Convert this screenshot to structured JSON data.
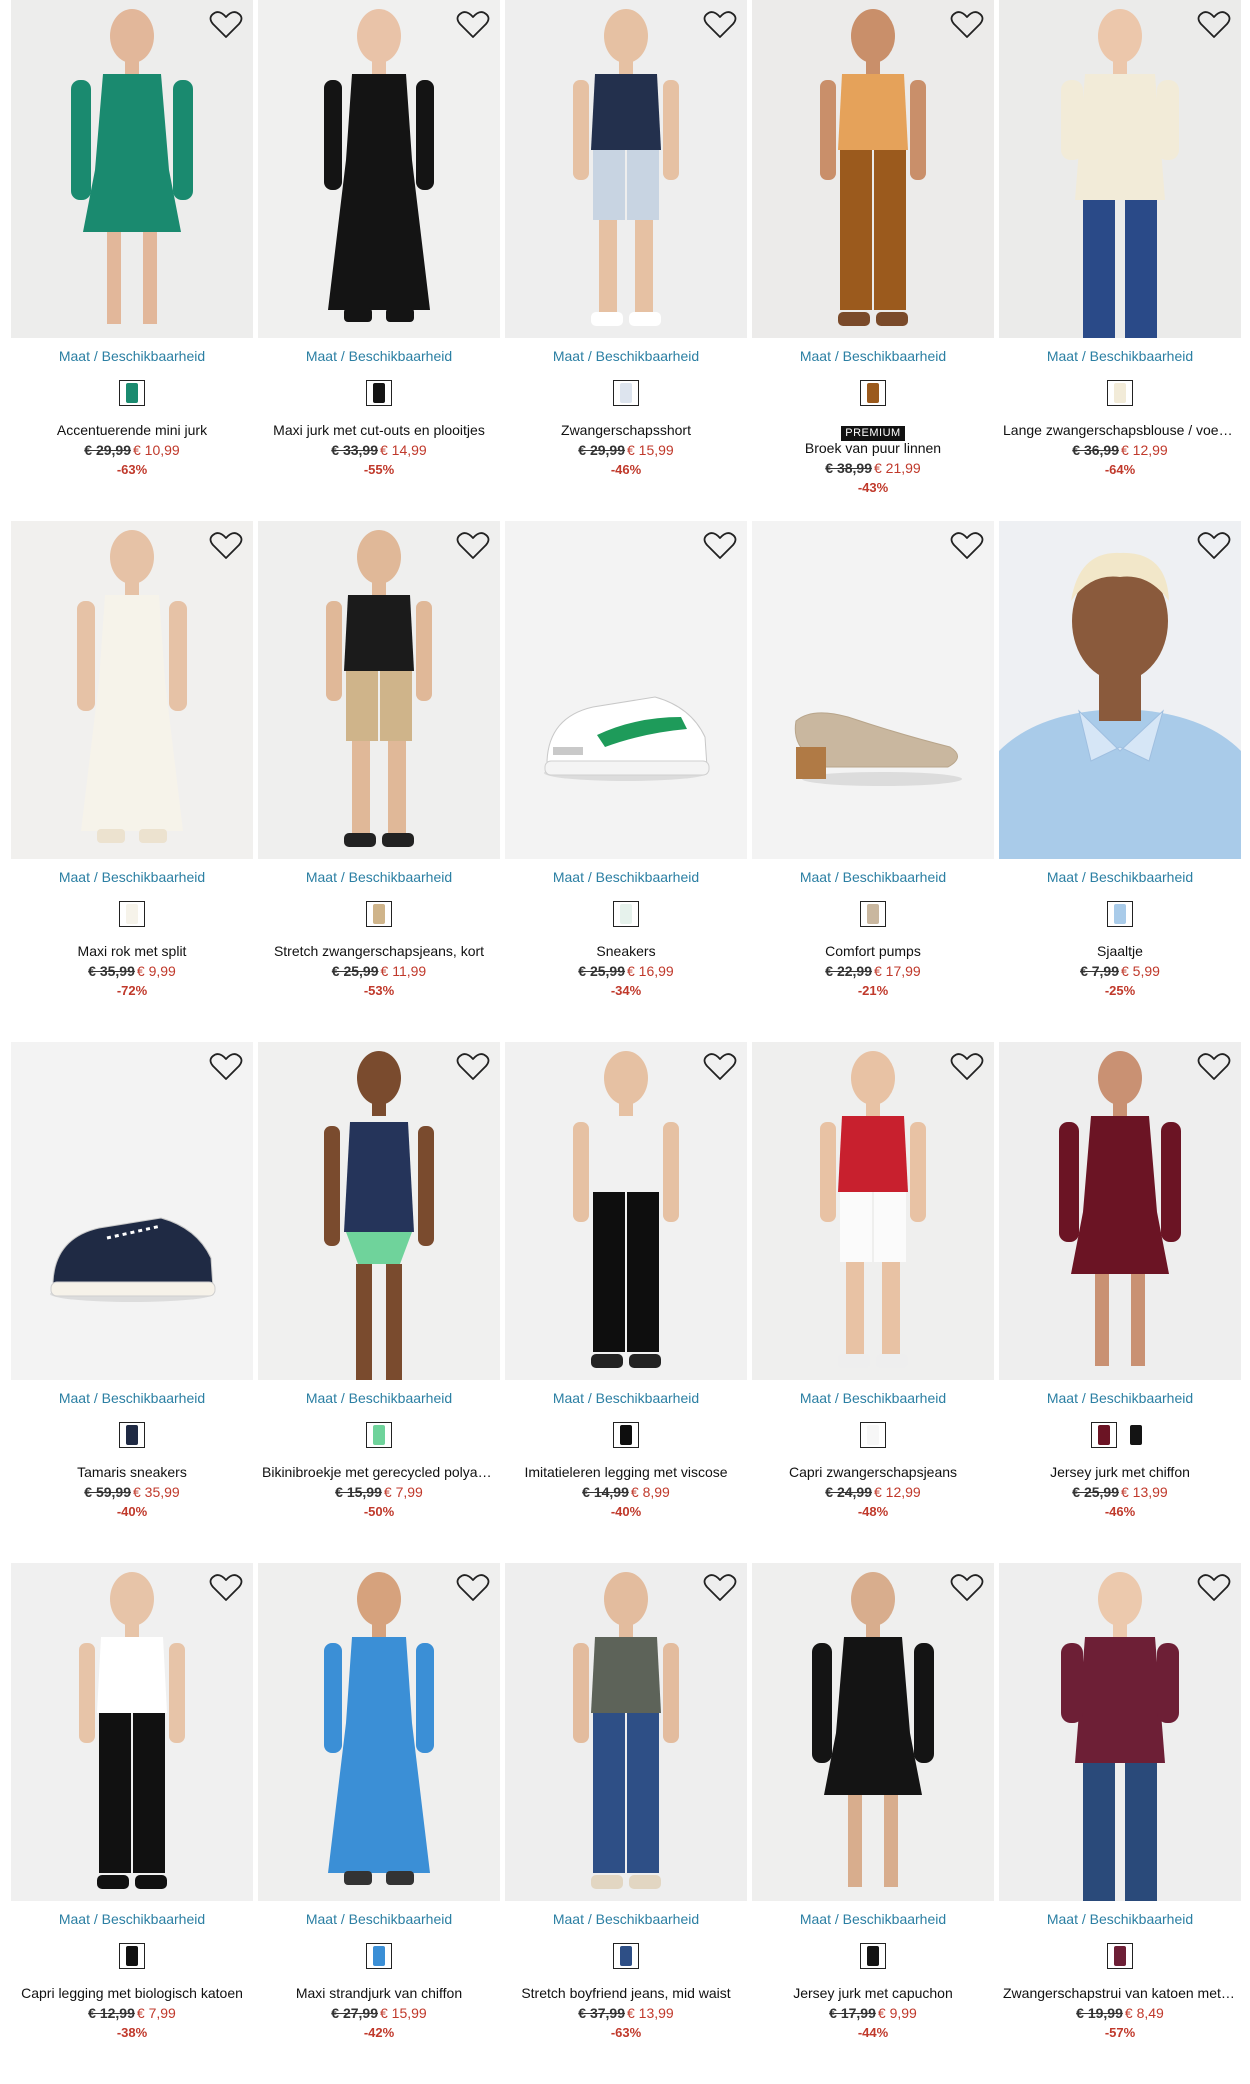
{
  "availability_label": "Maat / Beschikbaarheid",
  "premium_label": "PREMIUM",
  "products": [
    {
      "name": "Accentuerende mini jurk",
      "old_price": "€ 29,99",
      "new_price": "€ 10,99",
      "discount": "-63%",
      "bg": "#ededec",
      "garment": "#1a8a6f",
      "skin": "#e2b79a",
      "shoe": "#caa98a",
      "kind": "dress",
      "swatches": [
        "#1a8a6f"
      ]
    },
    {
      "name": "Maxi jurk met cut-outs en plooitjes",
      "old_price": "€ 33,99",
      "new_price": "€ 14,99",
      "discount": "-55%",
      "bg": "#f0f0ef",
      "garment": "#141414",
      "skin": "#e9c3a8",
      "shoe": "#141414",
      "kind": "long",
      "swatches": [
        "#141414"
      ]
    },
    {
      "name": "Zwangerschapsshort",
      "old_price": "€ 29,99",
      "new_price": "€ 15,99",
      "discount": "-46%",
      "bg": "#eeeeee",
      "garment": "#c8d4e2",
      "skin": "#e6c1a3",
      "shoe": "#ffffff",
      "kind": "short",
      "top": "#23304d",
      "swatches": [
        "#dde4ee"
      ]
    },
    {
      "name": "Broek van puur linnen",
      "old_price": "€ 38,99",
      "new_price": "€ 21,99",
      "discount": "-43%",
      "bg": "#ecebea",
      "garment": "#9b5a1d",
      "skin": "#c98f6a",
      "shoe": "#7a4a2a",
      "kind": "pants",
      "top": "#e5a25a",
      "premium": true,
      "swatches": [
        "#9b5a1d"
      ]
    },
    {
      "name": "Lange zwangerschapsblouse / voedingsblouse",
      "old_price": "€ 36,99",
      "new_price": "€ 12,99",
      "discount": "-64%",
      "bg": "#ebebea",
      "garment": "#f2ebd8",
      "skin": "#ecc7ab",
      "shoe": "#2a4a88",
      "kind": "tunic",
      "swatches": [
        "#f2ebd8"
      ]
    },
    {
      "name": "Maxi rok met split",
      "old_price": "€ 35,99",
      "new_price": "€ 9,99",
      "discount": "-72%",
      "bg": "#f1f0ee",
      "garment": "#f6f3ea",
      "skin": "#e6c2a6",
      "shoe": "#ece2cf",
      "kind": "long",
      "swatches": [
        "#f6f3ea"
      ]
    },
    {
      "name": "Stretch zwangerschapsjeans, kort",
      "old_price": "€ 25,99",
      "new_price": "€ 11,99",
      "discount": "-53%",
      "bg": "#efefee",
      "garment": "#cfb48a",
      "skin": "#e0b898",
      "shoe": "#222222",
      "kind": "short",
      "top": "#1b1b1b",
      "swatches": [
        "#cfb48a"
      ]
    },
    {
      "name": "Sneakers",
      "old_price": "€ 25,99",
      "new_price": "€ 16,99",
      "discount": "-34%",
      "bg": "#f3f3f3",
      "garment": "#ffffff",
      "accent": "#1e9b5a",
      "kind": "sneaker",
      "swatches": [
        "#e6f2ec"
      ]
    },
    {
      "name": "Comfort pumps",
      "old_price": "€ 22,99",
      "new_price": "€ 17,99",
      "discount": "-21%",
      "bg": "#f3f3f3",
      "garment": "#c9b79f",
      "accent": "#b07a45",
      "kind": "pump",
      "swatches": [
        "#c9b79f"
      ]
    },
    {
      "name": "Sjaaltje",
      "old_price": "€ 7,99",
      "new_price": "€ 5,99",
      "discount": "-25%",
      "bg": "#eef0f3",
      "garment": "#a9cbe9",
      "skin": "#8a5a3c",
      "kind": "portrait",
      "swatches": [
        "#a9cbe9"
      ]
    },
    {
      "name": "Tamaris sneakers",
      "old_price": "€ 59,99",
      "new_price": "€ 35,99",
      "discount": "-40%",
      "bg": "#f3f3f3",
      "garment": "#1f2a44",
      "accent": "#ffffff",
      "kind": "lowsneaker",
      "swatches": [
        "#1f2a44"
      ]
    },
    {
      "name": "Bikinibroekje met gerecycled polyamide",
      "old_price": "€ 15,99",
      "new_price": "€ 7,99",
      "discount": "-50%",
      "bg": "#f0f0ef",
      "garment": "#6fd39b",
      "skin": "#7a4b2e",
      "kind": "swim",
      "top": "#25345a",
      "swatches": [
        "#6fd39b"
      ]
    },
    {
      "name": "Imitatieleren legging met viscose",
      "old_price": "€ 14,99",
      "new_price": "€ 8,99",
      "discount": "-40%",
      "bg": "#f1f1f1",
      "garment": "#0e0e0e",
      "skin": "#e6c1a3",
      "shoe": "#222222",
      "kind": "pants",
      "top": "#f1f1f1",
      "swatches": [
        "#0e0e0e"
      ]
    },
    {
      "name": "Capri zwangerschapsjeans",
      "old_price": "€ 24,99",
      "new_price": "€ 12,99",
      "discount": "-48%",
      "bg": "#efefee",
      "garment": "#fbfbfb",
      "skin": "#e8c2a4",
      "shoe": "#eeeeee",
      "kind": "short",
      "top": "#c8202e",
      "swatches": [
        "#f7f7f7"
      ]
    },
    {
      "name": "Jersey jurk met chiffon",
      "old_price": "€ 25,99",
      "new_price": "€ 13,99",
      "discount": "-46%",
      "bg": "#eeeeee",
      "garment": "#6b1424",
      "skin": "#c99173",
      "shoe": "#222222",
      "kind": "dress",
      "swatches": [
        "#6b1424",
        "#141414"
      ]
    },
    {
      "name": "Capri legging met biologisch katoen",
      "old_price": "€ 12,99",
      "new_price": "€ 7,99",
      "discount": "-38%",
      "bg": "#f0f0f0",
      "garment": "#111111",
      "skin": "#e7c4a8",
      "shoe": "#111111",
      "kind": "pants",
      "top": "#ffffff",
      "swatches": [
        "#111111"
      ]
    },
    {
      "name": "Maxi strandjurk van chiffon",
      "old_price": "€ 27,99",
      "new_price": "€ 15,99",
      "discount": "-42%",
      "bg": "#efefee",
      "garment": "#3b8fd6",
      "skin": "#d6a27d",
      "shoe": "#333333",
      "kind": "long",
      "swatches": [
        "#3b8fd6"
      ]
    },
    {
      "name": "Stretch boyfriend jeans, mid waist",
      "old_price": "€ 37,99",
      "new_price": "€ 13,99",
      "discount": "-63%",
      "bg": "#eeeeee",
      "garment": "#2e4f86",
      "skin": "#e3bc9e",
      "shoe": "#e2d6c2",
      "kind": "pants",
      "top": "#5d6359",
      "swatches": [
        "#2e4f86"
      ]
    },
    {
      "name": "Jersey jurk met capuchon",
      "old_price": "€ 17,99",
      "new_price": "€ 9,99",
      "discount": "-44%",
      "bg": "#efefee",
      "garment": "#141414",
      "skin": "#d8ad8d",
      "shoe": "#141414",
      "kind": "dress",
      "swatches": [
        "#141414"
      ]
    },
    {
      "name": "Zwangerschapstrui van katoen met strikceintuur",
      "old_price": "€ 19,99",
      "new_price": "€ 8,49",
      "discount": "-57%",
      "bg": "#eeeeee",
      "garment": "#6d1f36",
      "skin": "#ecc9ad",
      "shoe": "#2a4a7a",
      "kind": "tunic",
      "swatches": [
        "#6d1f36"
      ]
    }
  ]
}
